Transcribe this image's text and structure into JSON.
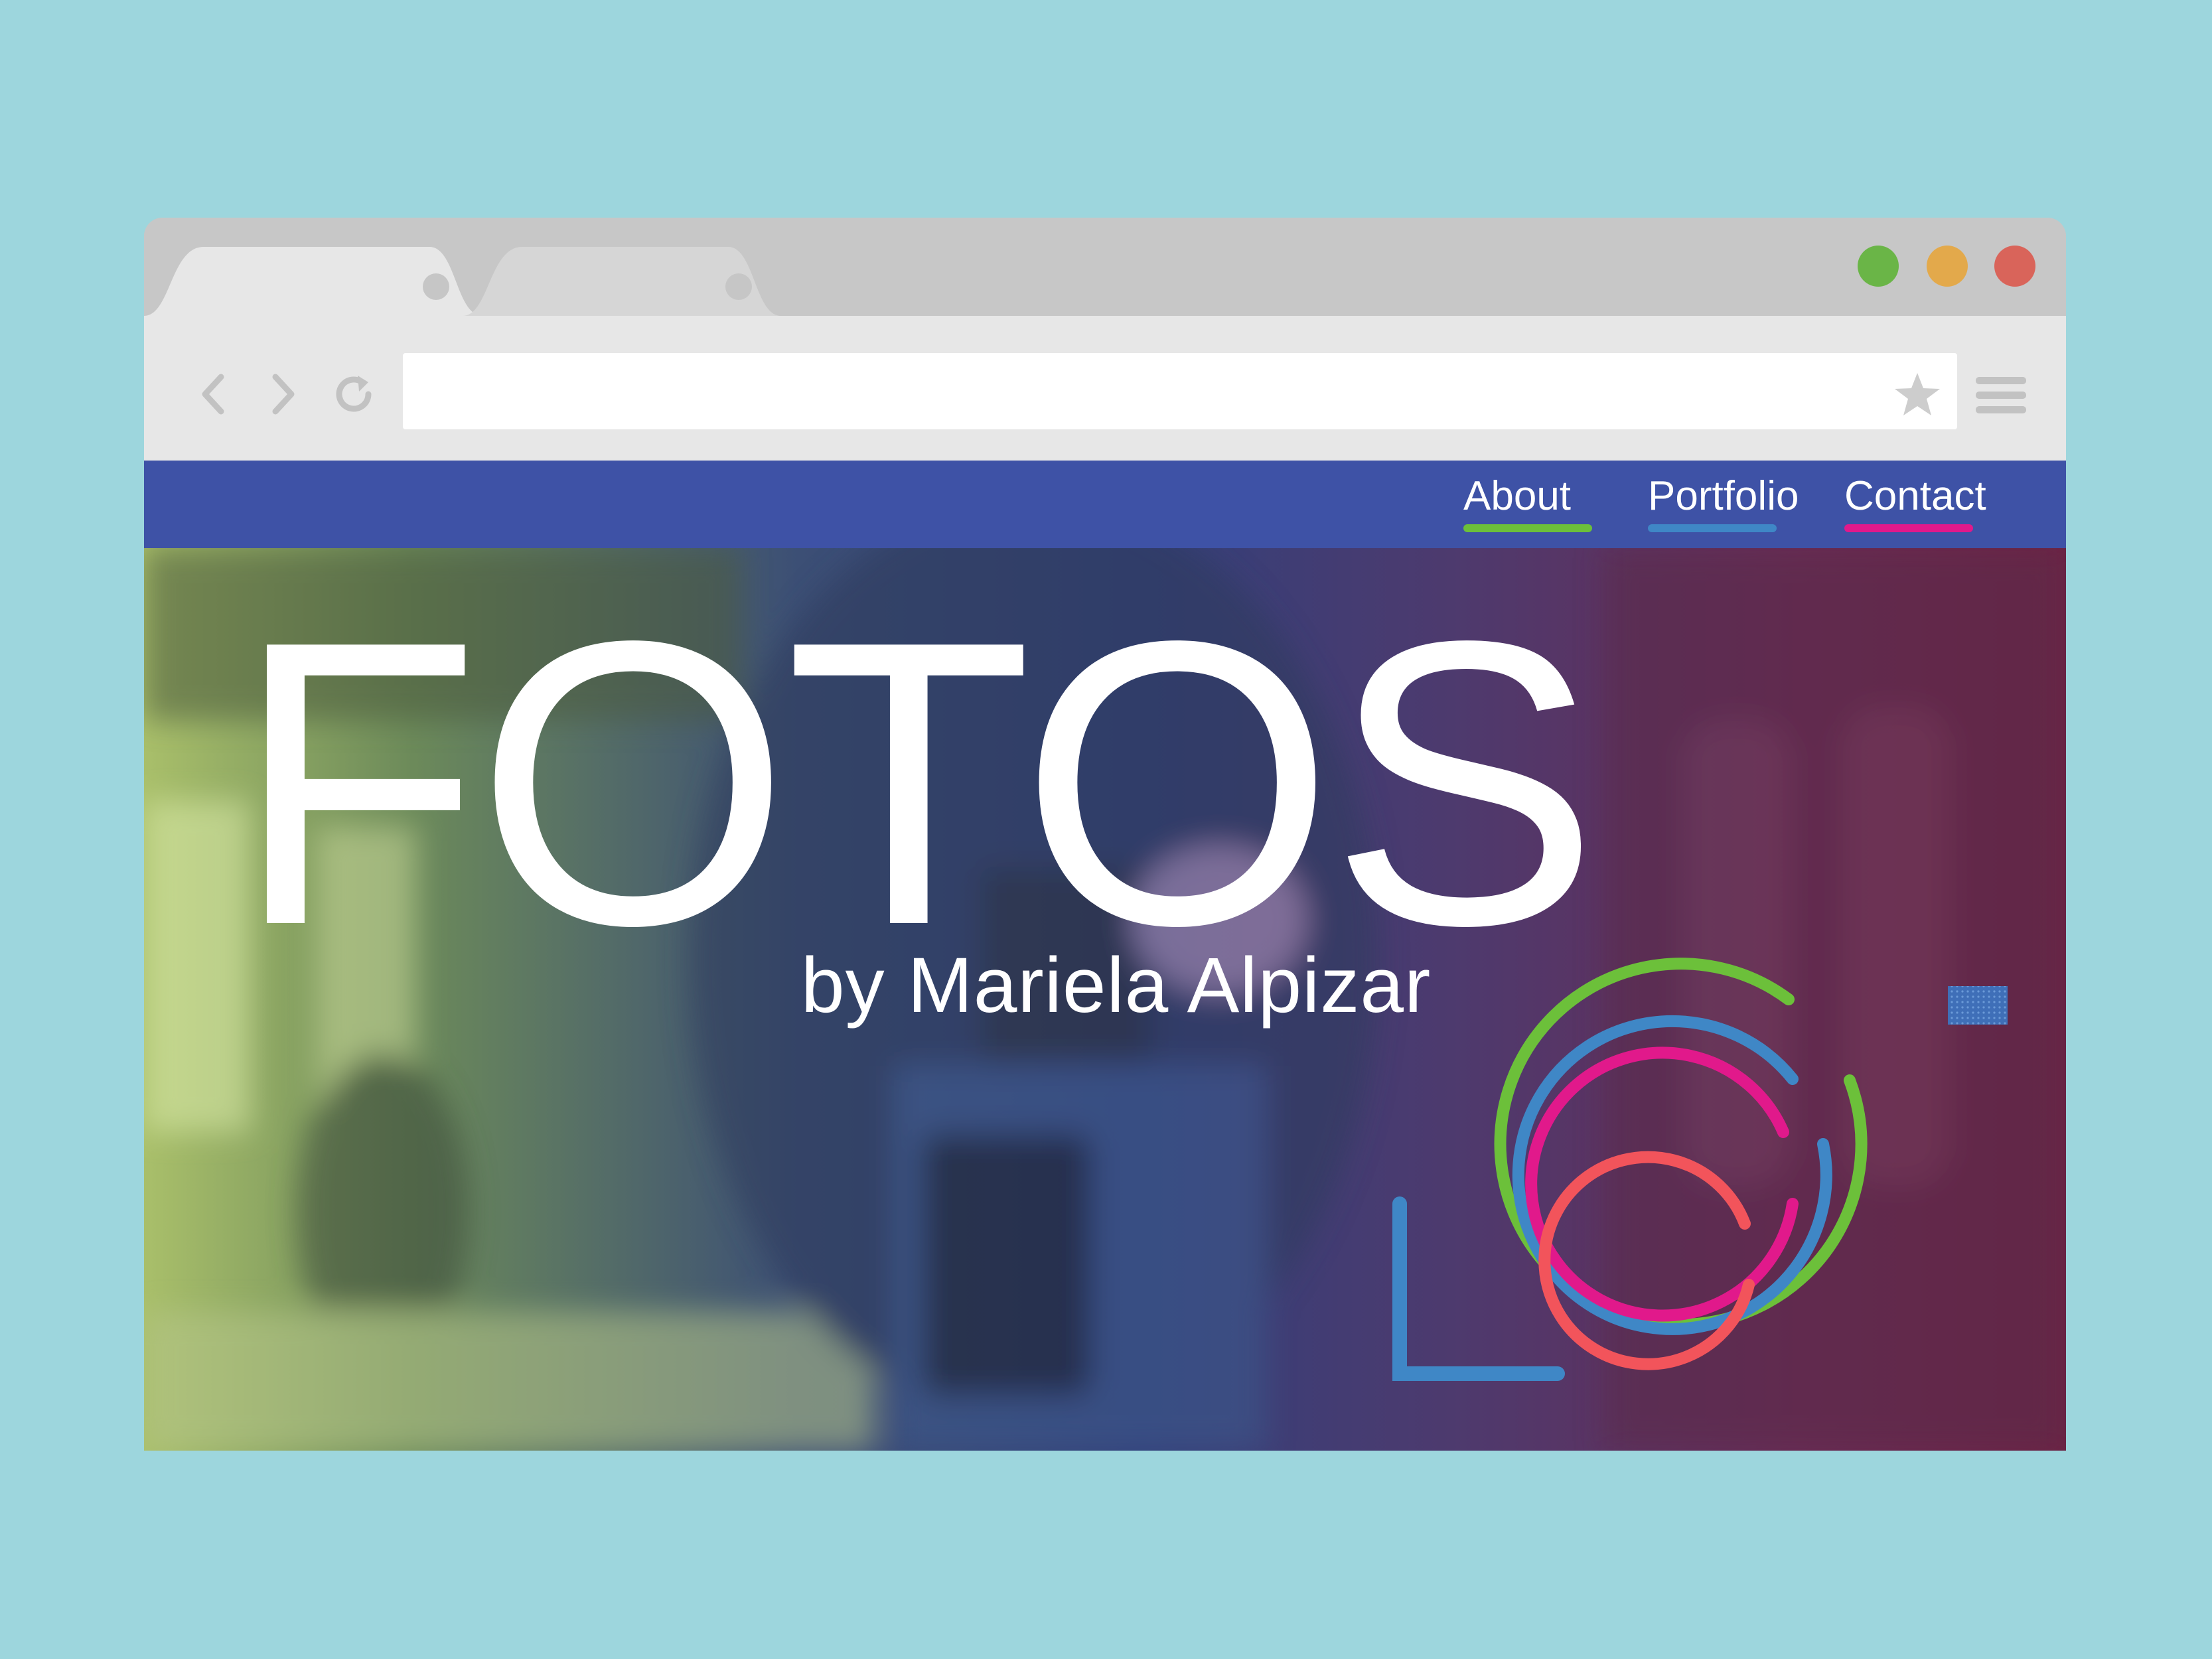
{
  "browser": {
    "tabs": [
      {
        "label": "",
        "active": true
      },
      {
        "label": "",
        "active": false
      }
    ],
    "window_buttons": [
      {
        "name": "green",
        "color": "#6ab547"
      },
      {
        "name": "yellow",
        "color": "#e3a94b"
      },
      {
        "name": "red",
        "color": "#d9645a"
      }
    ],
    "address_bar": {
      "value": "",
      "placeholder": ""
    },
    "icons": [
      "back-icon",
      "forward-icon",
      "reload-icon",
      "star-icon",
      "menu-icon"
    ]
  },
  "site": {
    "nav": [
      {
        "label": "About",
        "underline_color": "#6cc03a"
      },
      {
        "label": "Portfolio",
        "underline_color": "#3f87c6"
      },
      {
        "label": "Contact",
        "underline_color": "#e1198b"
      }
    ],
    "hero": {
      "title": "FOTOS",
      "subtitle": "by Mariela Alpizar"
    },
    "logo_colors": [
      "#6cc03a",
      "#3f87c6",
      "#e1198b",
      "#f2545b"
    ],
    "nav_bar_color": "#3e52a6"
  }
}
